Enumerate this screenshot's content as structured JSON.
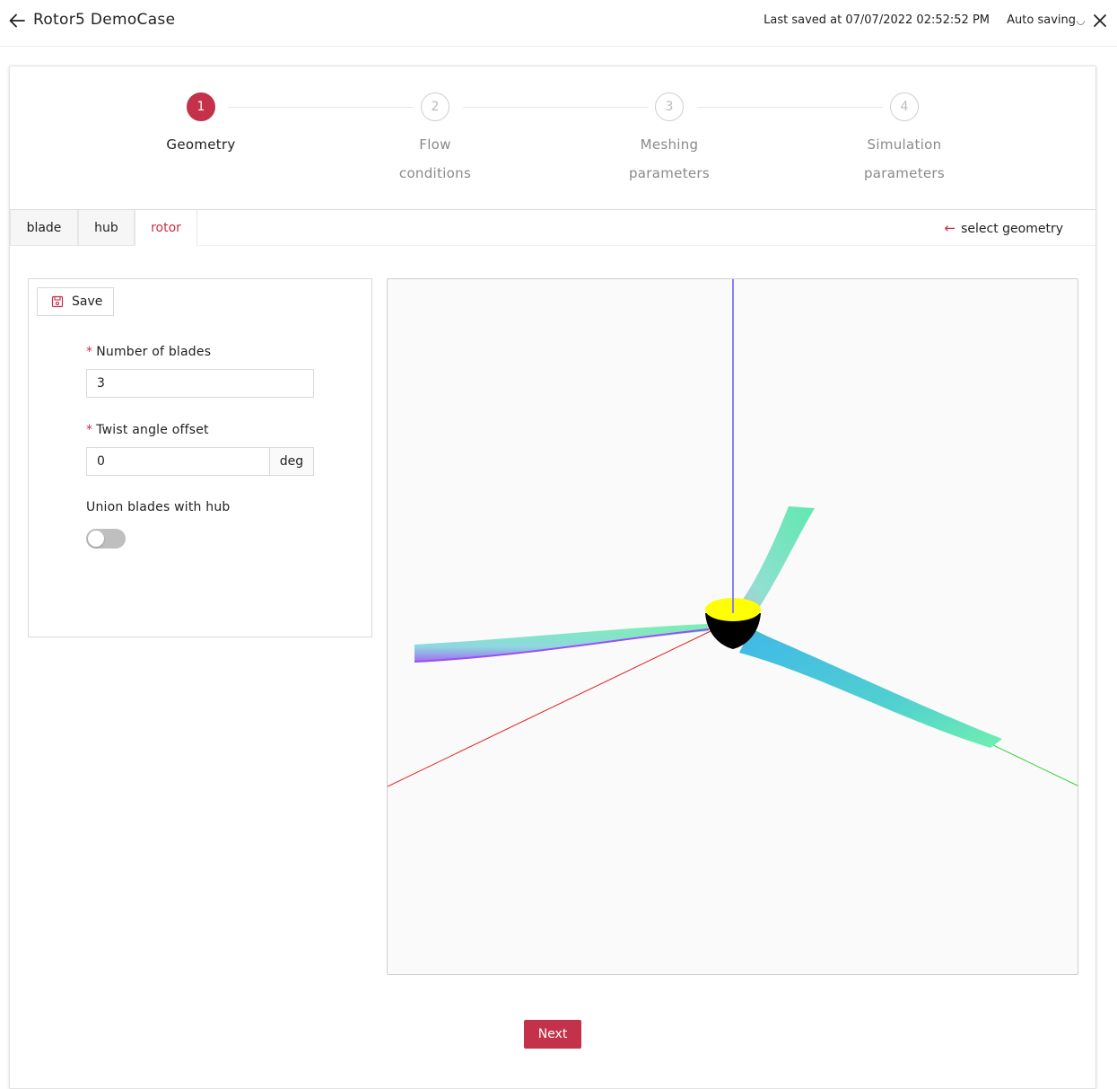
{
  "header": {
    "title": "Rotor5 DemoCase",
    "last_saved": "Last saved at 07/07/2022 02:52:52 PM",
    "auto_saving": "Auto saving"
  },
  "stepper": {
    "steps": [
      {
        "number": "1",
        "line1": "Geometry",
        "line2": "",
        "state": "active"
      },
      {
        "number": "2",
        "line1": "Flow",
        "line2": "conditions",
        "state": "inactive"
      },
      {
        "number": "3",
        "line1": "Meshing",
        "line2": "parameters",
        "state": "inactive"
      },
      {
        "number": "4",
        "line1": "Simulation",
        "line2": "parameters",
        "state": "inactive"
      }
    ]
  },
  "tabs": {
    "items": [
      "blade",
      "hub",
      "rotor"
    ],
    "active": "rotor",
    "select_geometry": "select geometry"
  },
  "form": {
    "save_label": "Save",
    "required_mark": "*",
    "blades_label": "Number of blades",
    "blades_value": "3",
    "twist_label": "Twist angle offset",
    "twist_value": "0",
    "twist_unit": "deg",
    "union_label": "Union blades with hub",
    "union_enabled": false
  },
  "footer": {
    "next_label": "Next"
  },
  "colors": {
    "accent": "#c4314b",
    "axis_x": "#e02020",
    "axis_y": "#30d030",
    "axis_z": "#8a80f0",
    "hub_top": "#ffff00",
    "hub_body": "#000000"
  }
}
